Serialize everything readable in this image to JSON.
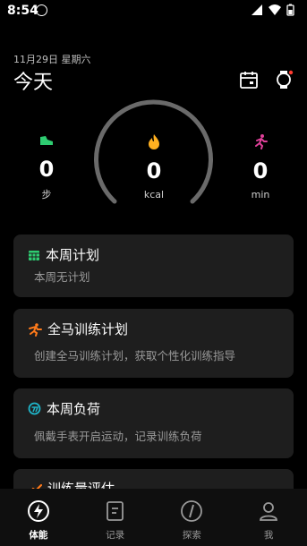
{
  "status_bar": {
    "time": "8:54"
  },
  "header": {
    "date": "11月29日 星期六",
    "title": "今天"
  },
  "stats": [
    {
      "value": "0",
      "unit": "步"
    },
    {
      "value": "0",
      "unit": "kcal"
    },
    {
      "value": "0",
      "unit": "min"
    }
  ],
  "cards": [
    {
      "title": "本周计划",
      "subtitle": "本周无计划",
      "icon": "calendar-icon"
    },
    {
      "title": "全马训练计划",
      "subtitle": "创建全马训练计划，获取个性化训练指导",
      "icon": "runner-icon"
    },
    {
      "title": "本周负荷",
      "subtitle": "佩戴手表开启运动，记录训练负荷",
      "icon": "load-icon"
    },
    {
      "title": "训练量评估",
      "subtitle": "",
      "icon": "assessment-icon"
    }
  ],
  "tabs": [
    {
      "label": "体能",
      "active": true
    },
    {
      "label": "记录",
      "active": false
    },
    {
      "label": "探索",
      "active": false
    },
    {
      "label": "我",
      "active": false
    }
  ],
  "colors": {
    "background": "#000000",
    "card": "#1e1e1e",
    "accent_orange": "#ff7a1a",
    "accent_green": "#2ecc71",
    "accent_pink": "#e0409a"
  }
}
